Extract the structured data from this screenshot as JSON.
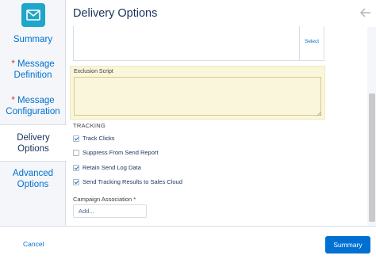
{
  "header": {
    "title": "Delivery Options"
  },
  "sidebar": {
    "items": [
      {
        "label_lines": [
          "Summary"
        ],
        "required": false,
        "active": false
      },
      {
        "label_lines": [
          "Message",
          "Definition"
        ],
        "required": true,
        "active": false
      },
      {
        "label_lines": [
          "Message",
          "Configuration"
        ],
        "required": true,
        "active": false
      },
      {
        "label_lines": [
          "Delivery",
          "Options"
        ],
        "required": false,
        "active": true
      },
      {
        "label_lines": [
          "Advanced",
          "Options"
        ],
        "required": false,
        "active": false
      }
    ],
    "required_marker": "*"
  },
  "main": {
    "select_link": "Select",
    "exclusion_script": {
      "label": "Exclusion Script",
      "value": ""
    },
    "tracking": {
      "heading": "TRACKING",
      "options": [
        {
          "label": "Track Clicks",
          "checked": true
        },
        {
          "label": "Suppress From Send Report",
          "checked": false
        },
        {
          "label": "Retain Send Log Data",
          "checked": true
        },
        {
          "label": "Send Tracking Results to Sales Cloud",
          "checked": true
        }
      ]
    },
    "campaign": {
      "label": "Campaign Association *",
      "placeholder": "Add..."
    }
  },
  "footer": {
    "cancel_label": "Cancel",
    "summary_label": "Summary"
  },
  "colors": {
    "accent": "#0070d2",
    "app_icon": "#1fa6c8",
    "highlight": "#faf6dc"
  },
  "icons": {
    "app": "email-envelope-icon",
    "back": "back-arrow-icon"
  }
}
